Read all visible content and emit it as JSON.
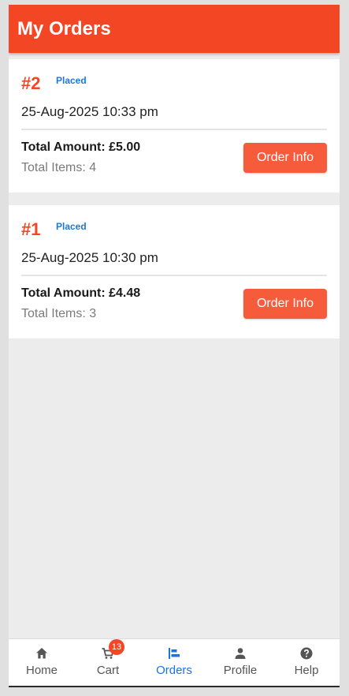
{
  "header": {
    "title": "My Orders"
  },
  "orders": [
    {
      "number": "#2",
      "status": "Placed",
      "date": "25-Aug-2025 10:33 pm",
      "total": "Total Amount: £5.00",
      "items": "Total Items: 4",
      "button": "Order Info"
    },
    {
      "number": "#1",
      "status": "Placed",
      "date": "25-Aug-2025 10:30 pm",
      "total": "Total Amount: £4.48",
      "items": "Total Items: 3",
      "button": "Order Info"
    }
  ],
  "nav": {
    "items": [
      {
        "label": "Home",
        "icon": "home-icon"
      },
      {
        "label": "Cart",
        "icon": "cart-icon",
        "badge": "13"
      },
      {
        "label": "Orders",
        "icon": "orders-icon",
        "active": true
      },
      {
        "label": "Profile",
        "icon": "profile-icon"
      },
      {
        "label": "Help",
        "icon": "help-icon"
      }
    ]
  },
  "colors": {
    "accent": "#f34624",
    "button": "#f65b3c",
    "status": "#1d78d6",
    "active_nav": "#1a73e8"
  }
}
